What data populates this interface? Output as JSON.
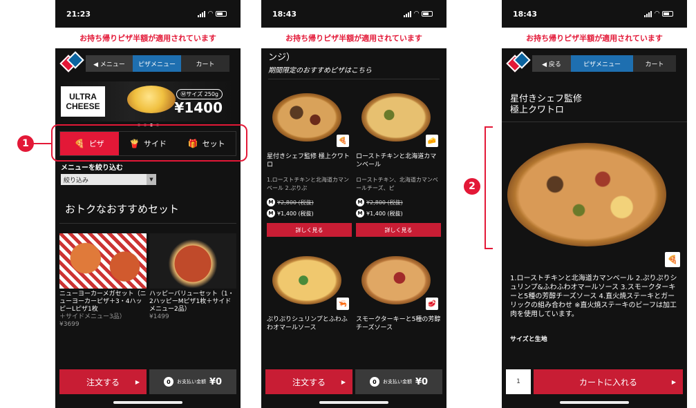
{
  "banner_text": "お持ち帰りピザ半額が適用されています",
  "screen1": {
    "time": "21:23",
    "nav": {
      "menu": "◀ メニュー",
      "pizza_menu": "ピザメニュー",
      "cart": "カート"
    },
    "hero": {
      "logo_line1": "ULTRA",
      "logo_line2": "CHEESE",
      "size_badge": "Ⓜサイズ 250g",
      "price": "¥1400"
    },
    "tabs": [
      {
        "label": "ピザ",
        "icon": "🍕"
      },
      {
        "label": "サイド",
        "icon": "🍟"
      },
      {
        "label": "セット",
        "icon": "🎁"
      }
    ],
    "filter": {
      "title": "メニューを絞り込む",
      "value": "絞り込み"
    },
    "section_title": "おトクなおすすめセット",
    "sets": [
      {
        "name": "ニューヨーカーメガセット（ニューヨーカーピザ＋3・4ハッピーLピザ1枚",
        "sub": "＋サイドメニュー3品）",
        "price": "¥3699"
      },
      {
        "name": "ハッピーバリューセット（1・2ハッピーMピザ1枚＋サイドメニュー2品）",
        "sub": "",
        "price": "¥1499"
      }
    ]
  },
  "screen2": {
    "time": "18:43",
    "fragment": "ンジ）",
    "subtitle": "期間限定のおすすめピザはこちら",
    "pizzas": [
      {
        "name": "星付きシェフ監修 極上クワトロ",
        "desc": "1.ローストチキンと北海道カマンベール 2.ぷりぷ",
        "old_price": "¥2,800 (税抜)",
        "price": "¥1,400 (税抜)",
        "detail": "詳しく見る",
        "tag_icon": "🍕"
      },
      {
        "name": "ローストチキンと北海道カマンベール",
        "desc": "ローストチキン、北海道カマンベールチーズ、ピ",
        "old_price": "¥2,800 (税抜)",
        "price": "¥1,400 (税抜)",
        "detail": "詳しく見る",
        "tag_icon": "🧀"
      },
      {
        "name": "ぷりぷりシュリンプとふわふわオマールソース",
        "tag_icon": "🦐"
      },
      {
        "name": "スモークターキーと5種の芳醇チーズソース",
        "tag_icon": "🥩"
      }
    ],
    "size_m": "M"
  },
  "screen3": {
    "time": "18:43",
    "nav": {
      "back": "◀ 戻る",
      "pizza_menu": "ピザメニュー",
      "cart": "カート"
    },
    "title_line1": "星付きシェフ監修",
    "title_line2": "極上クワトロ",
    "tag_icon": "🍕",
    "description": "1.ローストチキンと北海道カマンベール 2.ぷりぷりシュリンプ&ふわふわオマールソース 3.スモークターキーと5種の芳醇チーズソース 4.直火焼ステーキとガーリックの組み合わせ ※直火焼ステーキのビーフは加工肉を使用しています。",
    "size_label": "サイズと生地",
    "quantity": "1",
    "add_to_cart": "カートに入れる"
  },
  "bottom": {
    "order": "注文する",
    "count": "0",
    "total_label": "お支払い金額",
    "total": "¥0"
  },
  "callouts": [
    "1",
    "2"
  ],
  "colors": {
    "accent": "#e31837",
    "blue": "#1e6fb0",
    "bg": "#121212"
  }
}
